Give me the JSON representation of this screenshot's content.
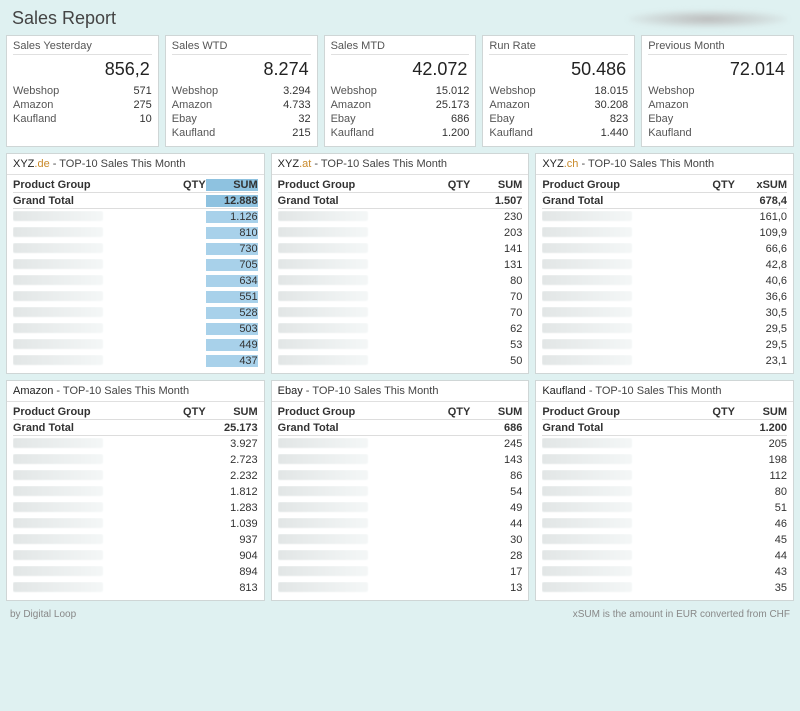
{
  "header": {
    "title": "Sales Report"
  },
  "kpis": [
    {
      "title": "Sales Yesterday",
      "value": "856,2",
      "lines": [
        [
          "Webshop",
          "571"
        ],
        [
          "Amazon",
          "275"
        ],
        [
          "Kaufland",
          "10"
        ]
      ]
    },
    {
      "title": "Sales WTD",
      "value": "8.274",
      "lines": [
        [
          "Webshop",
          "3.294"
        ],
        [
          "Amazon",
          "4.733"
        ],
        [
          "Ebay",
          "32"
        ],
        [
          "Kaufland",
          "215"
        ]
      ]
    },
    {
      "title": "Sales MTD",
      "value": "42.072",
      "lines": [
        [
          "Webshop",
          "15.012"
        ],
        [
          "Amazon",
          "25.173"
        ],
        [
          "Ebay",
          "686"
        ],
        [
          "Kaufland",
          "1.200"
        ]
      ]
    },
    {
      "title": "Run Rate",
      "value": "50.486",
      "lines": [
        [
          "Webshop",
          "18.015"
        ],
        [
          "Amazon",
          "30.208"
        ],
        [
          "Ebay",
          "823"
        ],
        [
          "Kaufland",
          "1.440"
        ]
      ]
    },
    {
      "title": "Previous Month",
      "value": "72.014",
      "lines": [
        [
          "Webshop",
          ""
        ],
        [
          "Amazon",
          ""
        ],
        [
          "Ebay",
          ""
        ],
        [
          "Kaufland",
          ""
        ]
      ]
    }
  ],
  "tables_top": [
    {
      "title_prefix": "XYZ",
      "title_domain": ".de",
      "title_suffix": " - TOP-10 Sales This Month",
      "cols": [
        "Product Group",
        "QTY",
        "SUM"
      ],
      "grand": "12.888",
      "highlight": true,
      "sums": [
        "1.126",
        "810",
        "730",
        "705",
        "634",
        "551",
        "528",
        "503",
        "449",
        "437"
      ]
    },
    {
      "title_prefix": "XYZ",
      "title_domain": ".at",
      "title_suffix": " - TOP-10 Sales This Month",
      "cols": [
        "Product Group",
        "QTY",
        "SUM"
      ],
      "grand": "1.507",
      "highlight": false,
      "sums": [
        "230",
        "203",
        "141",
        "131",
        "80",
        "70",
        "70",
        "62",
        "53",
        "50"
      ]
    },
    {
      "title_prefix": "XYZ",
      "title_domain": ".ch",
      "title_suffix": " - TOP-10 Sales This Month",
      "cols": [
        "Product Group",
        "QTY",
        "xSUM"
      ],
      "grand": "678,4",
      "highlight": false,
      "sums": [
        "161,0",
        "109,9",
        "66,6",
        "42,8",
        "40,6",
        "36,6",
        "30,5",
        "29,5",
        "29,5",
        "23,1"
      ]
    }
  ],
  "tables_bottom": [
    {
      "title_prefix": "Amazon",
      "title_domain": "",
      "title_suffix": " - TOP-10 Sales This Month",
      "cols": [
        "Product Group",
        "QTY",
        "SUM"
      ],
      "grand": "25.173",
      "highlight": false,
      "sums": [
        "3.927",
        "2.723",
        "2.232",
        "1.812",
        "1.283",
        "1.039",
        "937",
        "904",
        "894",
        "813"
      ]
    },
    {
      "title_prefix": "Ebay",
      "title_domain": "",
      "title_suffix": " - TOP-10 Sales This Month",
      "cols": [
        "Product Group",
        "QTY",
        "SUM"
      ],
      "grand": "686",
      "highlight": false,
      "sums": [
        "245",
        "143",
        "86",
        "54",
        "49",
        "44",
        "30",
        "28",
        "17",
        "13"
      ]
    },
    {
      "title_prefix": "Kaufland",
      "title_domain": "",
      "title_suffix": " - TOP-10 Sales This Month",
      "cols": [
        "Product Group",
        "QTY",
        "SUM"
      ],
      "grand": "1.200",
      "highlight": false,
      "sums": [
        "205",
        "198",
        "112",
        "80",
        "51",
        "46",
        "45",
        "44",
        "43",
        "35"
      ]
    }
  ],
  "footer": {
    "left": "by Digital Loop",
    "right": "xSUM is the amount in EUR converted from CHF"
  },
  "labels": {
    "grand_total": "Grand Total"
  },
  "chart_data": [
    {
      "type": "table",
      "title": "Sales Yesterday",
      "total": 856.2,
      "rows": [
        [
          "Webshop",
          571
        ],
        [
          "Amazon",
          275
        ],
        [
          "Kaufland",
          10
        ]
      ]
    },
    {
      "type": "table",
      "title": "Sales WTD",
      "total": 8274,
      "rows": [
        [
          "Webshop",
          3294
        ],
        [
          "Amazon",
          4733
        ],
        [
          "Ebay",
          32
        ],
        [
          "Kaufland",
          215
        ]
      ]
    },
    {
      "type": "table",
      "title": "Sales MTD",
      "total": 42072,
      "rows": [
        [
          "Webshop",
          15012
        ],
        [
          "Amazon",
          25173
        ],
        [
          "Ebay",
          686
        ],
        [
          "Kaufland",
          1200
        ]
      ]
    },
    {
      "type": "table",
      "title": "Run Rate",
      "total": 50486,
      "rows": [
        [
          "Webshop",
          18015
        ],
        [
          "Amazon",
          30208
        ],
        [
          "Ebay",
          823
        ],
        [
          "Kaufland",
          1440
        ]
      ]
    },
    {
      "type": "table",
      "title": "Previous Month",
      "total": 72014,
      "rows": [
        [
          "Webshop",
          null
        ],
        [
          "Amazon",
          null
        ],
        [
          "Ebay",
          null
        ],
        [
          "Kaufland",
          null
        ]
      ]
    },
    {
      "type": "table",
      "title": "XYZ.de - TOP-10 Sales This Month",
      "sum_col": "SUM",
      "grand_total": 12888,
      "values": [
        1126,
        810,
        730,
        705,
        634,
        551,
        528,
        503,
        449,
        437
      ]
    },
    {
      "type": "table",
      "title": "XYZ.at - TOP-10 Sales This Month",
      "sum_col": "SUM",
      "grand_total": 1507,
      "values": [
        230,
        203,
        141,
        131,
        80,
        70,
        70,
        62,
        53,
        50
      ]
    },
    {
      "type": "table",
      "title": "XYZ.ch - TOP-10 Sales This Month",
      "sum_col": "xSUM",
      "grand_total": 678.4,
      "values": [
        161.0,
        109.9,
        66.6,
        42.8,
        40.6,
        36.6,
        30.5,
        29.5,
        29.5,
        23.1
      ]
    },
    {
      "type": "table",
      "title": "Amazon - TOP-10 Sales This Month",
      "sum_col": "SUM",
      "grand_total": 25173,
      "values": [
        3927,
        2723,
        2232,
        1812,
        1283,
        1039,
        937,
        904,
        894,
        813
      ]
    },
    {
      "type": "table",
      "title": "Ebay - TOP-10 Sales This Month",
      "sum_col": "SUM",
      "grand_total": 686,
      "values": [
        245,
        143,
        86,
        54,
        49,
        44,
        30,
        28,
        17,
        13
      ]
    },
    {
      "type": "table",
      "title": "Kaufland - TOP-10 Sales This Month",
      "sum_col": "SUM",
      "grand_total": 1200,
      "values": [
        205,
        198,
        112,
        80,
        51,
        46,
        45,
        44,
        43,
        35
      ]
    }
  ]
}
